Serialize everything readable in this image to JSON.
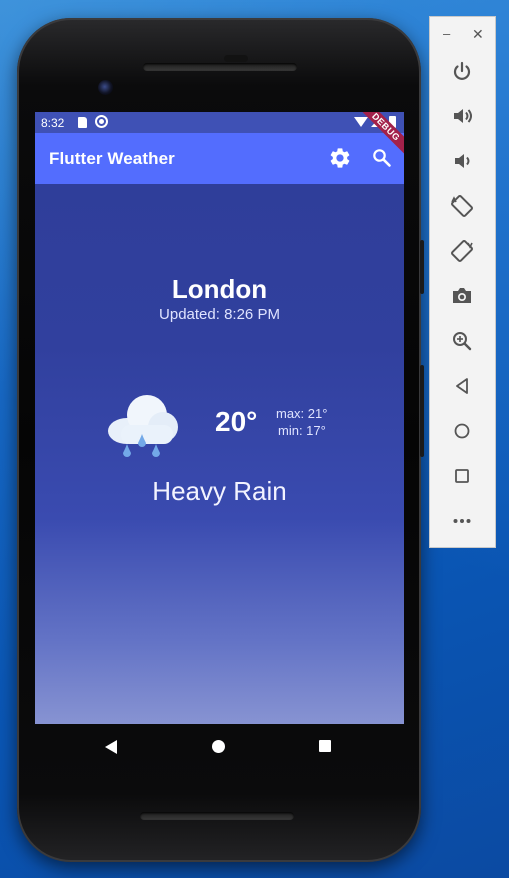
{
  "status_bar": {
    "time": "8:32"
  },
  "debug_banner": "DEBUG",
  "app_bar": {
    "title": "Flutter Weather",
    "actions": [
      "settings-icon",
      "search-icon"
    ]
  },
  "weather": {
    "city": "London",
    "updated": "Updated: 8:26 PM",
    "temperature": "20°",
    "max": "max: 21°",
    "min": "min: 17°",
    "condition": "Heavy Rain",
    "icon": "heavy-rain-cloud-icon"
  },
  "navigation": [
    "back-icon",
    "home-icon",
    "recents-icon"
  ],
  "emulator_toolbar": {
    "window_controls": [
      "–",
      "✕"
    ],
    "buttons": [
      "power-icon",
      "volume-up-icon",
      "volume-down-icon",
      "rotate-left-icon",
      "rotate-right-icon",
      "camera-icon",
      "zoom-icon",
      "back-icon",
      "home-icon",
      "overview-icon",
      "more-icon"
    ]
  },
  "colors": {
    "app_bar": "#536dfe",
    "status_bar": "#3f51b5",
    "background_top": "#2f3e9a",
    "background_bottom": "#8793d2",
    "debug_ribbon": "#a3214a"
  }
}
